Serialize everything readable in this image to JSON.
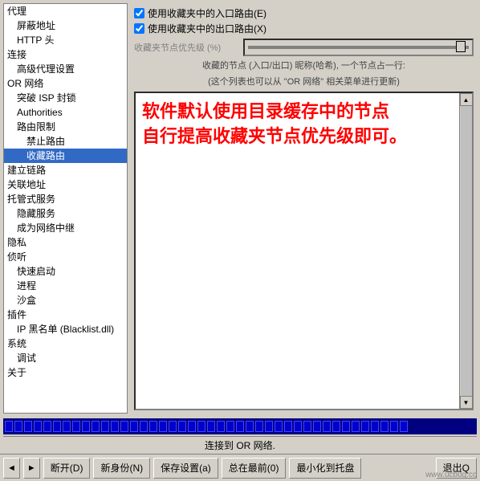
{
  "sidebar": {
    "items": [
      {
        "label": "代理",
        "indent": 0,
        "id": "proxy"
      },
      {
        "label": "屏蔽地址",
        "indent": 1,
        "id": "block-addr"
      },
      {
        "label": "HTTP 头",
        "indent": 1,
        "id": "http-head"
      },
      {
        "label": "连接",
        "indent": 0,
        "id": "connect"
      },
      {
        "label": "高级代理设置",
        "indent": 1,
        "id": "adv-proxy"
      },
      {
        "label": "OR 网络",
        "indent": 0,
        "id": "or-network"
      },
      {
        "label": "突破 ISP 封锁",
        "indent": 1,
        "id": "break-isp"
      },
      {
        "label": "Authorities",
        "indent": 1,
        "id": "authorities"
      },
      {
        "label": "路由限制",
        "indent": 1,
        "id": "route-limit"
      },
      {
        "label": "禁止路由",
        "indent": 2,
        "id": "forbid-route"
      },
      {
        "label": "收藏路由",
        "indent": 2,
        "id": "fav-route",
        "selected": true
      },
      {
        "label": "建立链路",
        "indent": 0,
        "id": "build-circuit"
      },
      {
        "label": "关联地址",
        "indent": 0,
        "id": "assoc-addr"
      },
      {
        "label": "托管式服务",
        "indent": 0,
        "id": "managed-svc"
      },
      {
        "label": "隐藏服务",
        "indent": 1,
        "id": "hidden-svc"
      },
      {
        "label": "成为网络中继",
        "indent": 1,
        "id": "become-relay"
      },
      {
        "label": "隐私",
        "indent": 0,
        "id": "privacy"
      },
      {
        "label": "侦听",
        "indent": 0,
        "id": "listen"
      },
      {
        "label": "快速启动",
        "indent": 1,
        "id": "quick-start"
      },
      {
        "label": "进程",
        "indent": 1,
        "id": "process"
      },
      {
        "label": "沙盒",
        "indent": 1,
        "id": "sandbox"
      },
      {
        "label": "插件",
        "indent": 0,
        "id": "plugins"
      },
      {
        "label": "IP 黑名单 (Blacklist.dll)",
        "indent": 1,
        "id": "blacklist"
      },
      {
        "label": "系统",
        "indent": 0,
        "id": "system"
      },
      {
        "label": "调试",
        "indent": 1,
        "id": "debug"
      },
      {
        "label": "关于",
        "indent": 0,
        "id": "about"
      }
    ]
  },
  "panel": {
    "checkbox1_label": "使用收藏夹中的入口路由(E)",
    "checkbox2_label": "使用收藏夹中的出口路由(X)",
    "slider_label": "收藏夹节点优先级 (%)",
    "info_line1": "收藏的节点 (入口/出口) 昵称(哈希), 一个节点占一行:",
    "info_line2": "(这个列表也可以从 \"OR 网络\" 相关菜单进行更新)",
    "main_text_line1": "软件默认使用目录缓存中的节点",
    "main_text_line2": "自行提高收藏夹节点优先级即可。"
  },
  "progress_blocks": 42,
  "status_text": "连接到 OR 网络.",
  "buttons": {
    "nav_back": "◄",
    "nav_fwd": "►",
    "disconnect": "断开(D)",
    "new_identity": "新身份(N)",
    "save_settings": "保存设置(a)",
    "always_on_top": "总在最前(0)",
    "minimize_tray": "最小化到托盘",
    "exit": "退出Q"
  },
  "watermark": "www.ucbug.cc"
}
